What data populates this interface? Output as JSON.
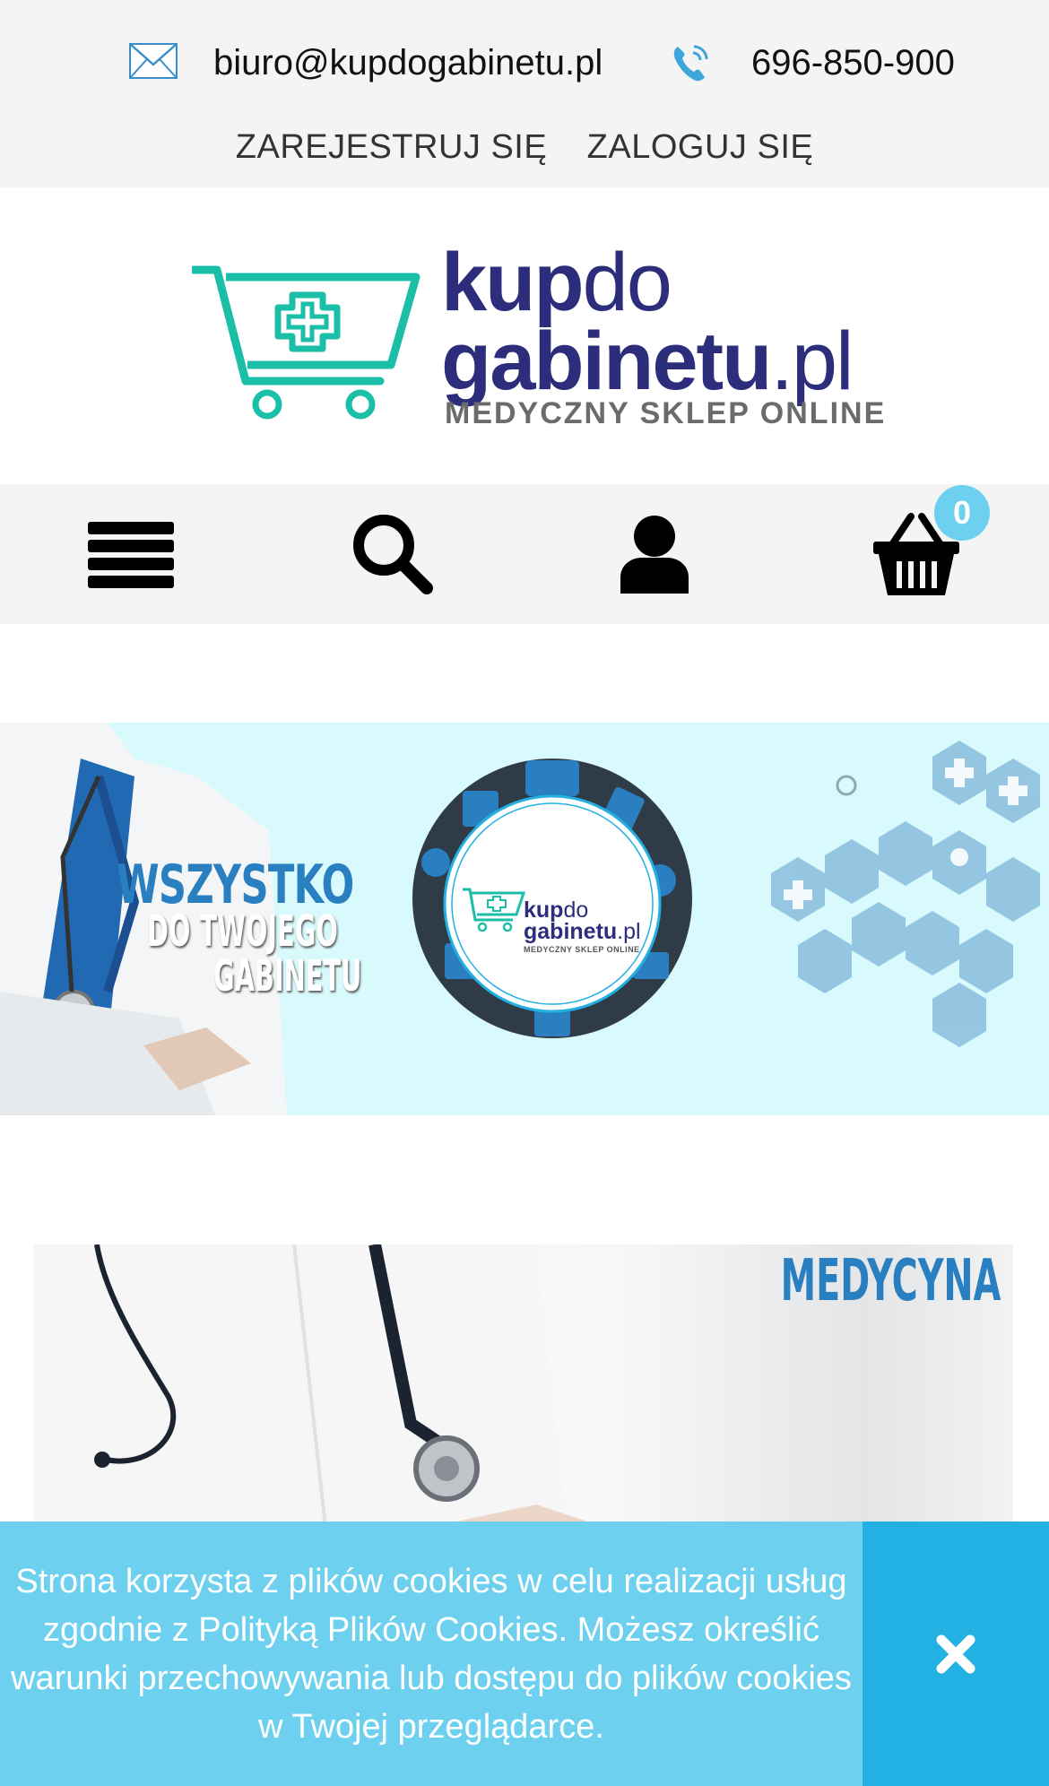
{
  "contact": {
    "email": "biuro@kupdogabinetu.pl",
    "phone": "696-850-900",
    "email_icon": "envelope-icon",
    "phone_icon": "phone-icon"
  },
  "auth": {
    "register": "ZAREJESTRUJ SIĘ",
    "login": "ZALOGUJ SIĘ"
  },
  "logo": {
    "word1_bold": "kup",
    "word1_thin": "do",
    "word2_bold": "gabinetu",
    "word2_thin": ".pl",
    "tagline": "MEDYCZNY SKLEP ONLINE",
    "icon": "cart-cross-logo",
    "brand_color": "#2c2e7b",
    "accent_color": "#1bbfa8"
  },
  "nav": {
    "icons": [
      "hamburger-menu-icon",
      "search-icon",
      "user-icon",
      "basket-icon"
    ],
    "cart_count": "0"
  },
  "hero": {
    "line1": "WSZYSTKO",
    "line2": "DO TWOJEGO",
    "line3": "GABINETU",
    "circle_word1_bold": "kup",
    "circle_word1_thin": "do",
    "circle_word2_bold": "gabinetu",
    "circle_word2_thin": ".pl",
    "circle_tagline": "MEDYCZNY SKLEP ONLINE",
    "background": "#d9fafc"
  },
  "banner2": {
    "title": "MEDYCYNA"
  },
  "cookie": {
    "text": "Strona korzysta z plików cookies w celu realizacji usług zgodnie z Polityką Plików Cookies. Możesz określić warunki przechowywania lub dostępu do plików cookies w Twojej przeglądarce.",
    "close_icon": "close-icon",
    "color": "#6dd0ef",
    "close_color": "#23b0e3"
  }
}
